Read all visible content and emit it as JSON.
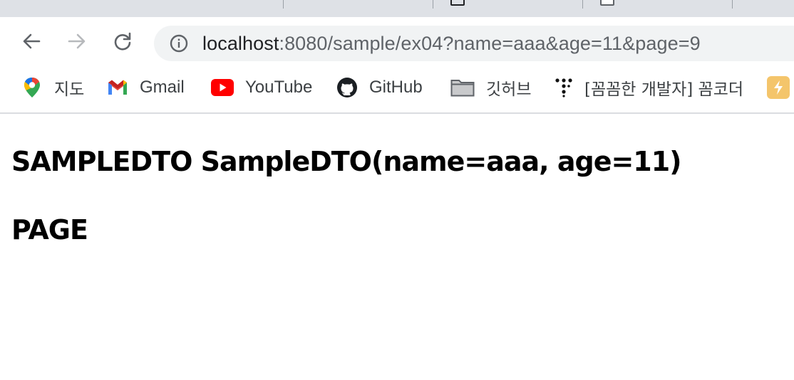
{
  "browser": {
    "url_host": "localhost",
    "url_rest": ":8080/sample/ex04?name=aaa&age=11&page=9"
  },
  "bookmarks": [
    {
      "label": "지도",
      "icon": "maps-pin-icon"
    },
    {
      "label": "Gmail",
      "icon": "gmail-icon"
    },
    {
      "label": "YouTube",
      "icon": "youtube-icon"
    },
    {
      "label": "GitHub",
      "icon": "github-icon"
    },
    {
      "label": "깃허브",
      "icon": "folder-icon"
    },
    {
      "label": "[꼼꼼한 개발자] 꼼코더",
      "icon": "dots-logo-icon"
    },
    {
      "label": "",
      "icon": "lightning-icon"
    }
  ],
  "page": {
    "line1": "SAMPLEDTO SampleDTO(name=aaa, age=11)",
    "line2": "PAGE"
  },
  "colors": {
    "tabstrip": "#dee1e6",
    "omnibox": "#f1f3f4",
    "youtube_red": "#ff0000",
    "lightning_bg": "#f4c56b"
  }
}
